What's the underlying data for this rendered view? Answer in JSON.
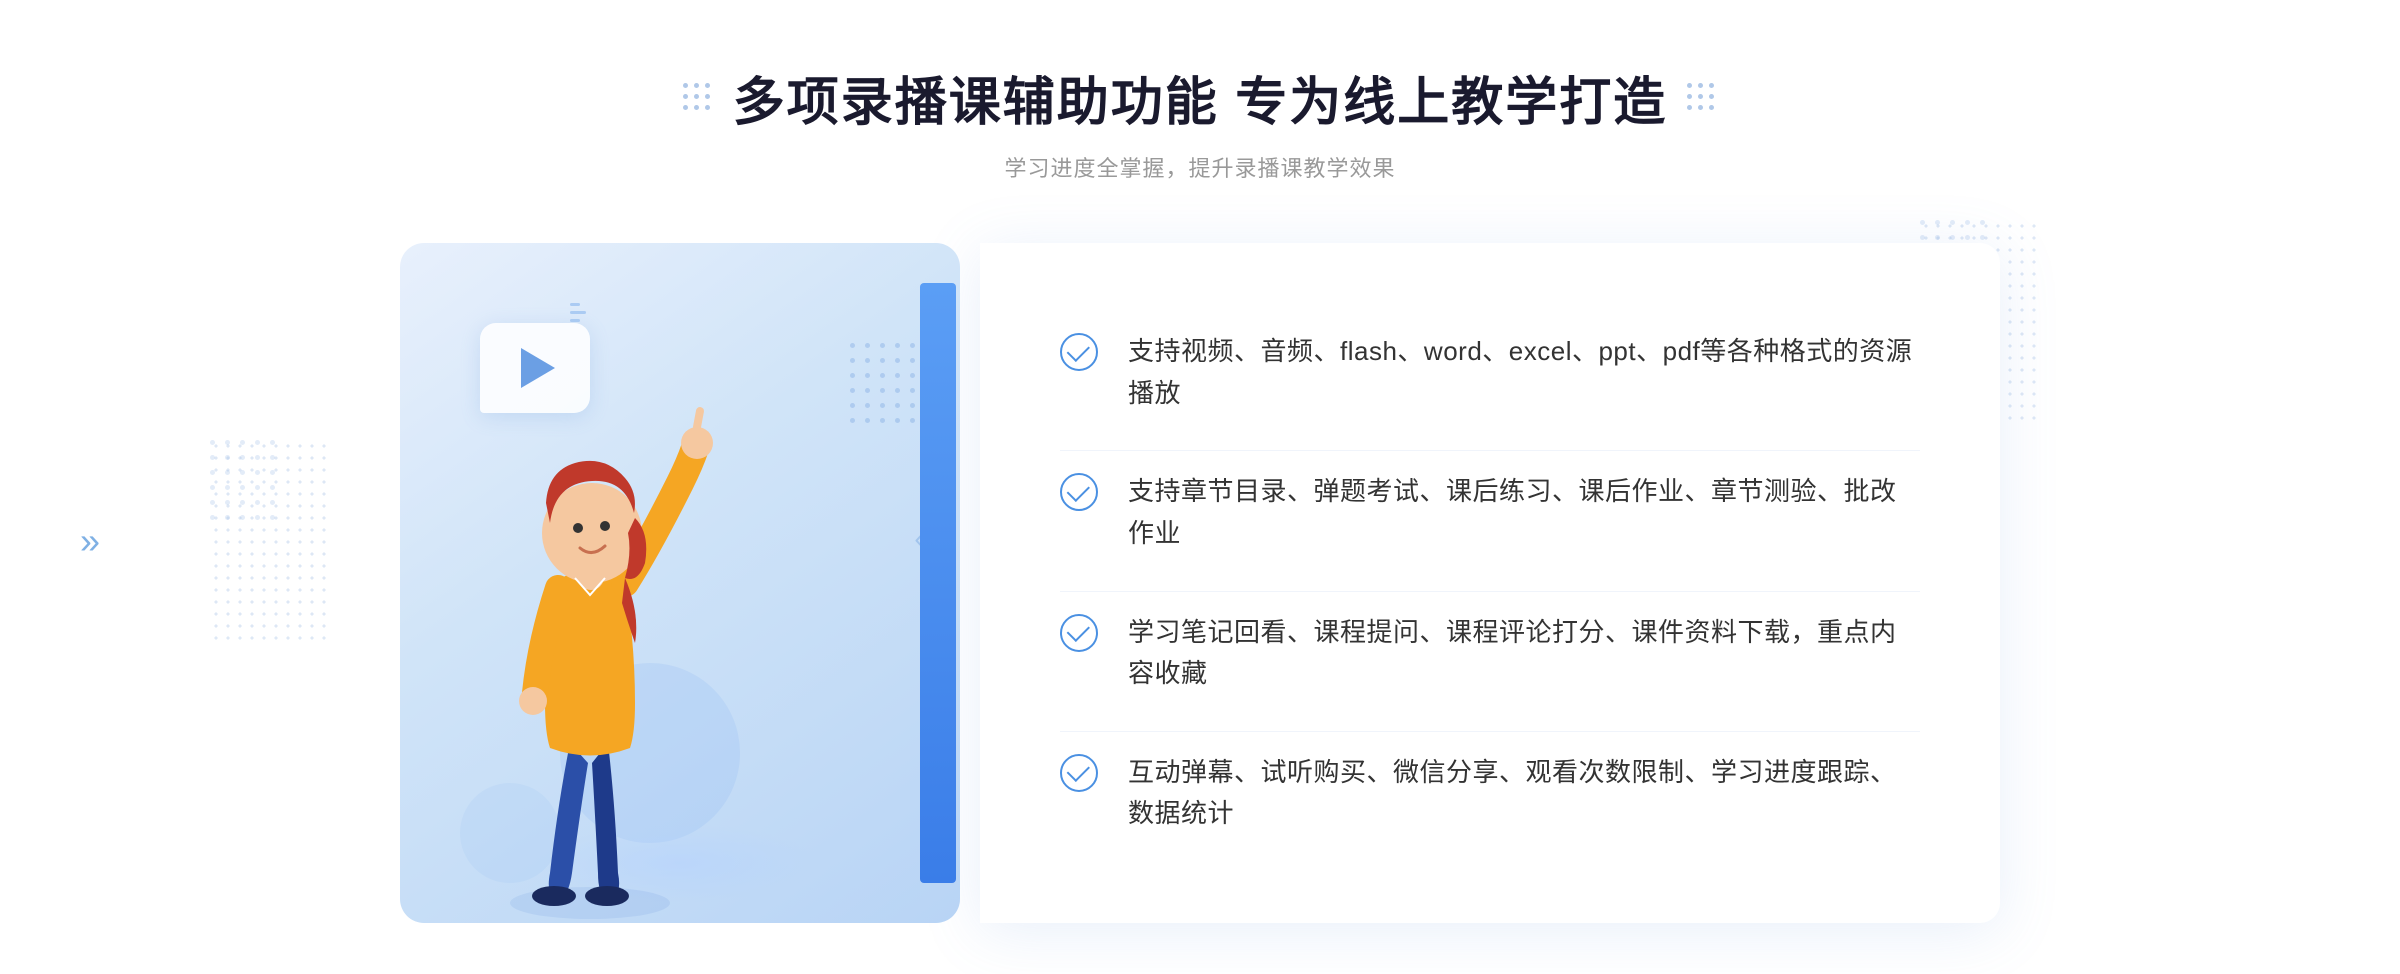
{
  "page": {
    "background": "#ffffff"
  },
  "header": {
    "title": "多项录播课辅助功能 专为线上教学打造",
    "subtitle": "学习进度全掌握，提升录播课教学效果"
  },
  "features": [
    {
      "id": 1,
      "text": "支持视频、音频、flash、word、excel、ppt、pdf等各种格式的资源播放"
    },
    {
      "id": 2,
      "text": "支持章节目录、弹题考试、课后练习、课后作业、章节测验、批改作业"
    },
    {
      "id": 3,
      "text": "学习笔记回看、课程提问、课程评论打分、课件资料下载，重点内容收藏"
    },
    {
      "id": 4,
      "text": "互动弹幕、试听购买、微信分享、观看次数限制、学习进度跟踪、数据统计"
    }
  ],
  "icons": {
    "check": "✓",
    "play": "▶",
    "arrows_left": "»",
    "arrows_right": "»"
  }
}
